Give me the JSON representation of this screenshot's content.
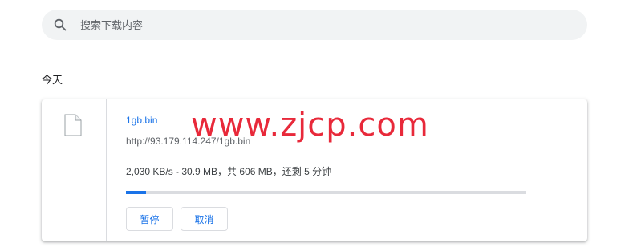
{
  "search": {
    "placeholder": "搜索下载内容",
    "icon": "search-icon"
  },
  "date_group": {
    "label": "今天"
  },
  "download": {
    "file_name": "1gb.bin",
    "url": "http://93.179.114.247/1gb.bin",
    "progress_text": "2,030 KB/s - 30.9 MB，共 606 MB，还剩 5 分钟",
    "progress_fraction": 0.051,
    "file_icon": "file-icon",
    "pause_label": "暂停",
    "cancel_label": "取消"
  },
  "watermark": {
    "text": "www.zjcp.com"
  },
  "colors": {
    "accent": "#1a73e8",
    "track": "#dadce0",
    "search_bg": "#f1f3f4",
    "watermark": "#e8293a"
  }
}
